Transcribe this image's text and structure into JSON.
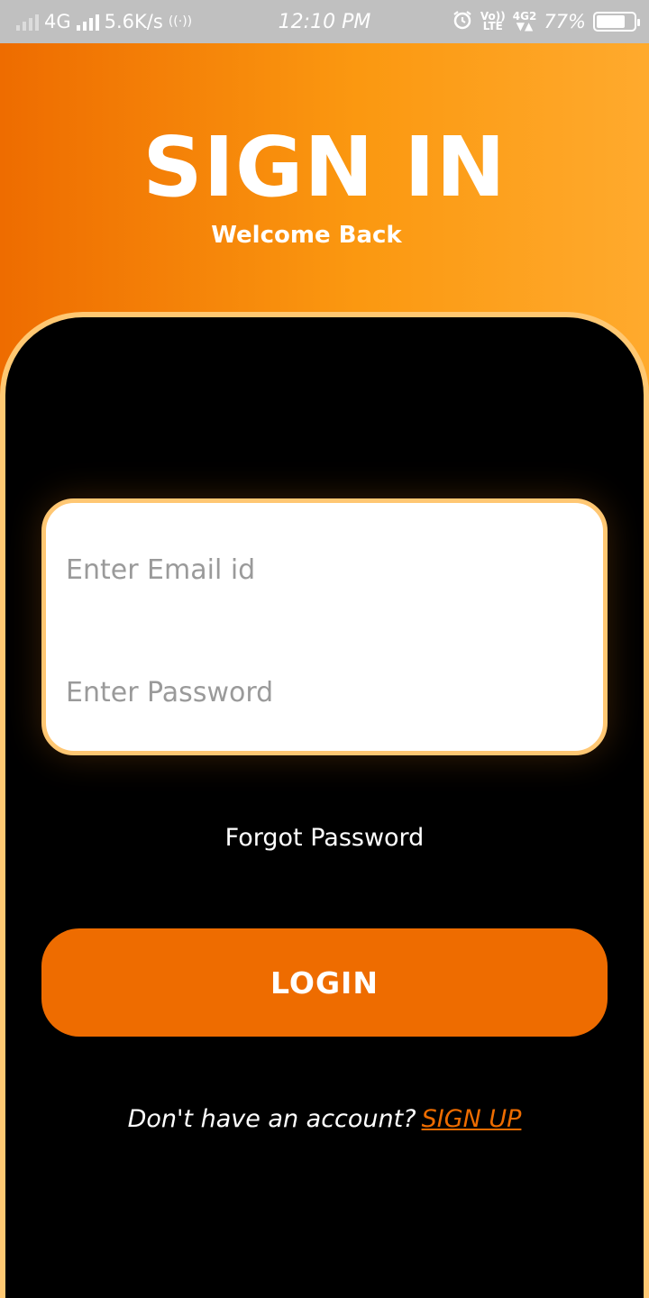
{
  "status_bar": {
    "network": "4G",
    "speed": "5.6K/s",
    "time": "12:10 PM",
    "volte_top": "Vo))",
    "volte_bottom": "LTE",
    "net2_top": "4G2",
    "net2_bottom": "▼▲",
    "battery_percent": "77%",
    "battery_level": 0.77,
    "icons": [
      "signal-dim-icon",
      "signal-icon",
      "hotspot-icon",
      "alarm-icon",
      "volte-icon",
      "data-icon",
      "battery-icon"
    ]
  },
  "header": {
    "title": "SIGN IN",
    "subtitle": "Welcome Back"
  },
  "form": {
    "email_placeholder": "Enter Email id",
    "password_placeholder": "Enter Password",
    "forgot_label": "Forgot Password",
    "login_label": "LOGIN"
  },
  "footer": {
    "prompt": "Don't have an account?",
    "signup_label": "SIGN UP"
  },
  "colors": {
    "accent": "#ee6c00",
    "gradient_end": "#ffaa2d",
    "card_border": "#ffc872",
    "background": "#000000",
    "status_bar": "#c0c0c0"
  }
}
